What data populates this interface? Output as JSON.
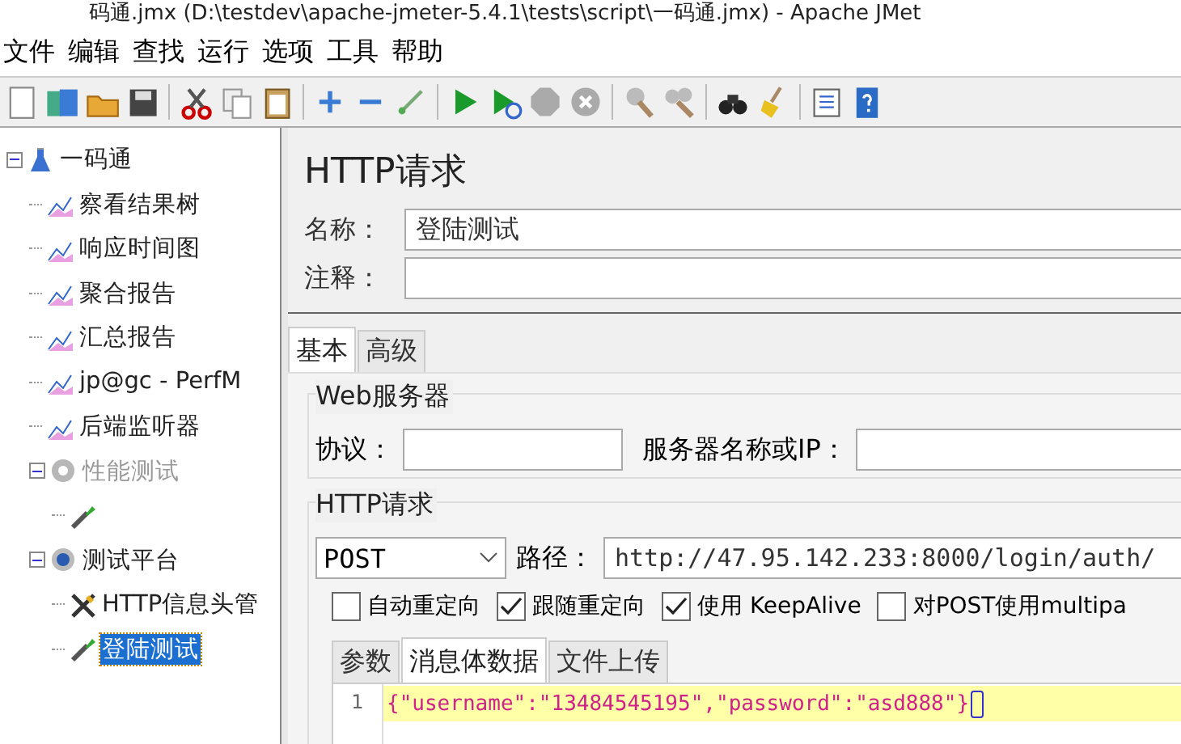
{
  "window": {
    "title": "码通.jmx (D:\\testdev\\apache-jmeter-5.4.1\\tests\\script\\一码通.jmx) - Apache JMet"
  },
  "menu": [
    "文件",
    "编辑",
    "查找",
    "运行",
    "选项",
    "工具",
    "帮助"
  ],
  "tree": [
    {
      "label": "一码通",
      "kind": "plan",
      "selected": false,
      "disabled": false,
      "expanded": true,
      "children": [
        {
          "label": "察看结果树",
          "kind": "listener",
          "selected": false,
          "disabled": false
        },
        {
          "label": "响应时间图",
          "kind": "listener",
          "selected": false,
          "disabled": false
        },
        {
          "label": "聚合报告",
          "kind": "listener",
          "selected": false,
          "disabled": false
        },
        {
          "label": "汇总报告",
          "kind": "listener",
          "selected": false,
          "disabled": false
        },
        {
          "label": "jp@gc - PerfM",
          "kind": "listener",
          "selected": false,
          "disabled": false
        },
        {
          "label": "后端监听器",
          "kind": "listener",
          "selected": false,
          "disabled": false
        },
        {
          "label": "性能测试",
          "kind": "group",
          "selected": false,
          "disabled": true,
          "expanded": true,
          "children": [
            {
              "kind": "sampler",
              "selected": false,
              "disabled": false
            }
          ]
        },
        {
          "label": "测试平台",
          "kind": "group",
          "selected": false,
          "disabled": false,
          "expanded": true,
          "children": [
            {
              "label": "HTTP信息头管",
              "kind": "config",
              "selected": false,
              "disabled": false
            },
            {
              "label": "登陆测试",
              "kind": "sampler",
              "selected": true,
              "disabled": false
            }
          ]
        }
      ]
    }
  ],
  "panel": {
    "title": "HTTP请求",
    "name": {
      "label": "名称：",
      "value": "登陆测试"
    },
    "comment": {
      "label": "注释："
    },
    "tabs": [
      {
        "label": "基本",
        "selected": true
      },
      {
        "label": "高级",
        "selected": false
      }
    ],
    "web_server": {
      "title": "Web服务器",
      "protocol_label": "协议：",
      "server_label": "服务器名称或IP："
    },
    "http_request": {
      "title": "HTTP请求",
      "method": "POST",
      "path_label": "路径：",
      "path": "http://47.95.142.233:8000/login/auth/",
      "options": [
        {
          "label": "自动重定向",
          "checked": false
        },
        {
          "label": "跟随重定向",
          "checked": true
        },
        {
          "label": "使用 KeepAlive",
          "checked": true
        },
        {
          "label": "对POST使用multipa",
          "checked": false
        }
      ]
    },
    "body_tabs": [
      {
        "label": "参数",
        "selected": false
      },
      {
        "label": "消息体数据",
        "selected": true
      },
      {
        "label": "文件上传",
        "selected": false
      }
    ],
    "body": [
      {
        "line": "1",
        "text": "{\"username\":\"13484545195\",\"password\":\"asd888\"}"
      }
    ]
  }
}
